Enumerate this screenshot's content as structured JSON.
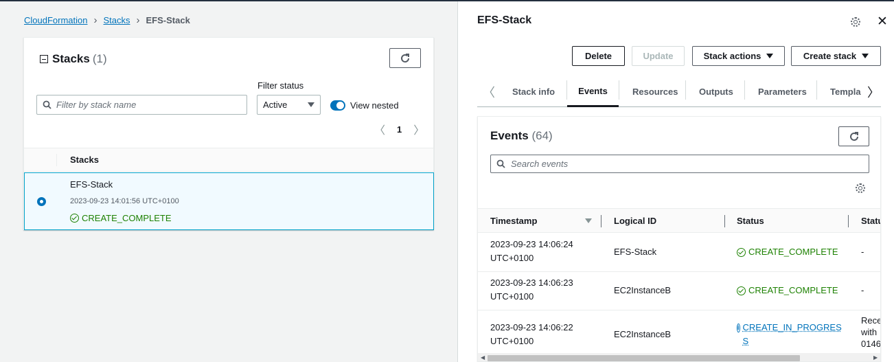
{
  "breadcrumb": {
    "root": "CloudFormation",
    "stacks": "Stacks",
    "current": "EFS-Stack"
  },
  "stacks_panel": {
    "title": "Stacks",
    "count": "(1)",
    "filter_placeholder": "Filter by stack name",
    "filter_status_label": "Filter status",
    "filter_status_value": "Active",
    "view_nested_label": "View nested",
    "view_nested_on": true,
    "page": "1",
    "column_header": "Stacks",
    "rows": [
      {
        "name": "EFS-Stack",
        "created": "2023-09-23 14:01:56 UTC+0100",
        "status": "CREATE_COMPLETE",
        "selected": true
      }
    ]
  },
  "detail": {
    "title": "EFS-Stack",
    "buttons": {
      "delete": "Delete",
      "update": "Update",
      "stack_actions": "Stack actions",
      "create_stack": "Create stack"
    },
    "tabs": [
      "Stack info",
      "Events",
      "Resources",
      "Outputs",
      "Parameters",
      "Templa"
    ],
    "active_tab": "Events"
  },
  "events": {
    "title": "Events",
    "count": "(64)",
    "search_placeholder": "Search events",
    "columns": [
      "Timestamp",
      "Logical ID",
      "Status",
      "Statu"
    ],
    "rows": [
      {
        "timestamp_line1": "2023-09-23 14:06:24",
        "timestamp_line2": "UTC+0100",
        "logical_id": "EFS-Stack",
        "status": "CREATE_COMPLETE",
        "status_type": "success",
        "reason": "-"
      },
      {
        "timestamp_line1": "2023-09-23 14:06:23",
        "timestamp_line2": "UTC+0100",
        "logical_id": "EC2InstanceB",
        "status": "CREATE_COMPLETE",
        "status_type": "success",
        "reason": "-"
      },
      {
        "timestamp_line1": "2023-09-23 14:06:22",
        "timestamp_line2": "UTC+0100",
        "logical_id": "EC2InstanceB",
        "status_line1": "CREATE_IN_PROGRES",
        "status_line2": "S",
        "status_type": "info",
        "reason_line1": "Recei",
        "reason_line2": "with",
        "reason_line3": "0146"
      }
    ]
  },
  "icons": {
    "breadcrumb_separator": "chevron-right-icon",
    "refresh": "refresh-icon",
    "search": "search-icon",
    "settings": "gear-icon",
    "close": "close-icon",
    "success": "check-circle-icon",
    "info": "info-circle-icon"
  },
  "colors": {
    "link": "#0073bb",
    "success": "#1d8102",
    "info": "#0073bb",
    "selected_row_bg": "#f1faff",
    "selected_row_border": "#00a1c9"
  }
}
